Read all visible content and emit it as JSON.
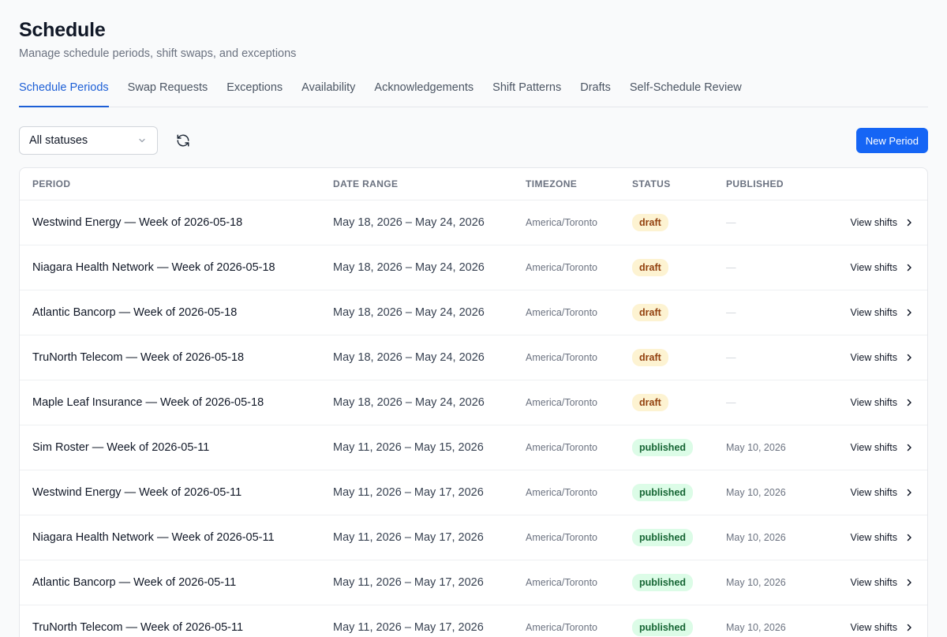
{
  "header": {
    "title": "Schedule",
    "subtitle": "Manage schedule periods, shift swaps, and exceptions"
  },
  "tabs": [
    {
      "label": "Schedule Periods",
      "active": true
    },
    {
      "label": "Swap Requests"
    },
    {
      "label": "Exceptions"
    },
    {
      "label": "Availability"
    },
    {
      "label": "Acknowledgements"
    },
    {
      "label": "Shift Patterns"
    },
    {
      "label": "Drafts"
    },
    {
      "label": "Self-Schedule Review"
    }
  ],
  "toolbar": {
    "status_filter": "All statuses",
    "refresh_icon": "refresh-icon",
    "new_button": "New Period"
  },
  "colors": {
    "accent": "#1565f5",
    "draft_bg": "#fdf3d2",
    "draft_text": "#92400e",
    "published_bg": "#dcfce7",
    "published_text": "#166534"
  },
  "table": {
    "columns": [
      "Period",
      "Date Range",
      "Timezone",
      "Status",
      "Published"
    ],
    "rows": [
      {
        "period": "Westwind Energy — Week of 2026-05-18",
        "date_range": "May 18, 2026 – May 24, 2026",
        "timezone": "America/Toronto",
        "status": "draft",
        "published": "—",
        "action": "View shifts"
      },
      {
        "period": "Niagara Health Network — Week of 2026-05-18",
        "date_range": "May 18, 2026 – May 24, 2026",
        "timezone": "America/Toronto",
        "status": "draft",
        "published": "—",
        "action": "View shifts"
      },
      {
        "period": "Atlantic Bancorp — Week of 2026-05-18",
        "date_range": "May 18, 2026 – May 24, 2026",
        "timezone": "America/Toronto",
        "status": "draft",
        "published": "—",
        "action": "View shifts"
      },
      {
        "period": "TruNorth Telecom — Week of 2026-05-18",
        "date_range": "May 18, 2026 – May 24, 2026",
        "timezone": "America/Toronto",
        "status": "draft",
        "published": "—",
        "action": "View shifts"
      },
      {
        "period": "Maple Leaf Insurance — Week of 2026-05-18",
        "date_range": "May 18, 2026 – May 24, 2026",
        "timezone": "America/Toronto",
        "status": "draft",
        "published": "—",
        "action": "View shifts"
      },
      {
        "period": "Sim Roster — Week of 2026-05-11",
        "date_range": "May 11, 2026 – May 15, 2026",
        "timezone": "America/Toronto",
        "status": "published",
        "published": "May 10, 2026",
        "action": "View shifts"
      },
      {
        "period": "Westwind Energy — Week of 2026-05-11",
        "date_range": "May 11, 2026 – May 17, 2026",
        "timezone": "America/Toronto",
        "status": "published",
        "published": "May 10, 2026",
        "action": "View shifts"
      },
      {
        "period": "Niagara Health Network — Week of 2026-05-11",
        "date_range": "May 11, 2026 – May 17, 2026",
        "timezone": "America/Toronto",
        "status": "published",
        "published": "May 10, 2026",
        "action": "View shifts"
      },
      {
        "period": "Atlantic Bancorp — Week of 2026-05-11",
        "date_range": "May 11, 2026 – May 17, 2026",
        "timezone": "America/Toronto",
        "status": "published",
        "published": "May 10, 2026",
        "action": "View shifts"
      },
      {
        "period": "TruNorth Telecom — Week of 2026-05-11",
        "date_range": "May 11, 2026 – May 17, 2026",
        "timezone": "America/Toronto",
        "status": "published",
        "published": "May 10, 2026",
        "action": "View shifts"
      }
    ]
  }
}
